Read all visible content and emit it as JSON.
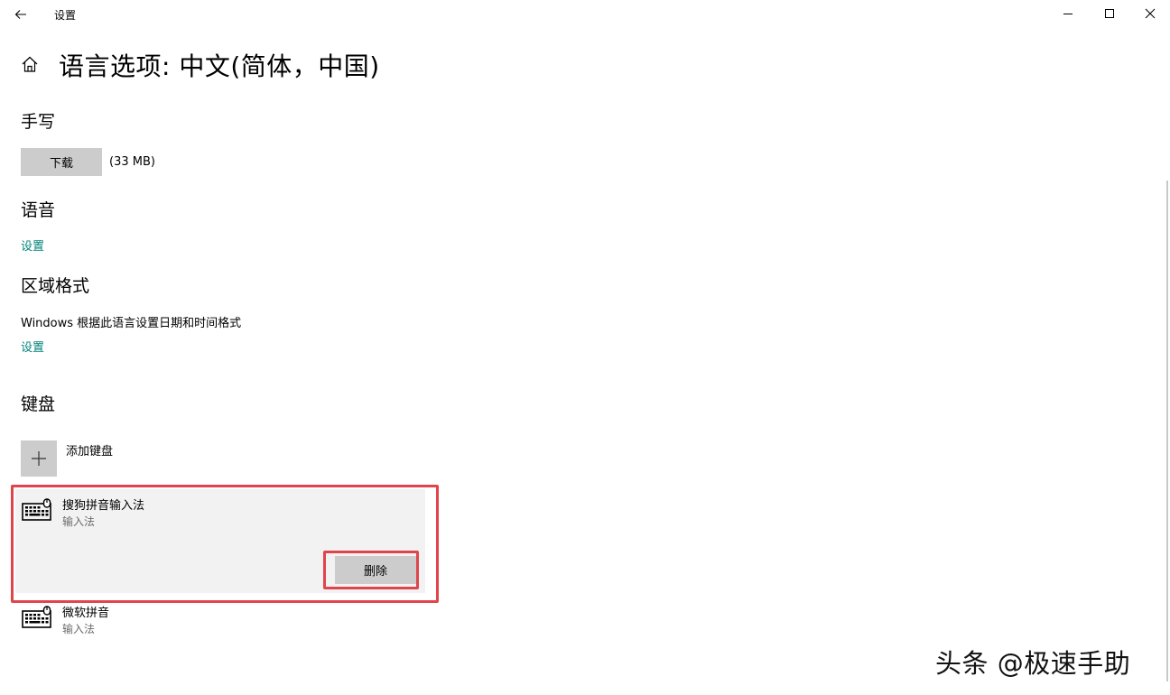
{
  "window": {
    "title": "设置"
  },
  "page": {
    "title": "语言选项: 中文(简体，中国)"
  },
  "handwriting": {
    "title": "手写",
    "download_label": "下载",
    "size_text": "(33 MB)"
  },
  "speech": {
    "title": "语音",
    "settings_link": "设置"
  },
  "region": {
    "title": "区域格式",
    "description": "Windows 根据此语言设置日期和时间格式",
    "settings_link": "设置"
  },
  "keyboard": {
    "title": "键盘",
    "add_label": "添加键盘",
    "items": [
      {
        "name": "搜狗拼音输入法",
        "subtitle": "输入法",
        "action_label": "删除",
        "selected": true
      },
      {
        "name": "微软拼音",
        "subtitle": "输入法",
        "selected": false
      }
    ]
  },
  "watermark": {
    "text": "头条 @极速手助"
  },
  "colors": {
    "link": "#00827a",
    "button_bg": "#cccccc",
    "selected_bg": "#f2f2f2",
    "highlight": "#e0454b"
  },
  "icons": {
    "back": "back-arrow-icon",
    "home": "home-icon",
    "minimize": "minimize-icon",
    "maximize": "maximize-icon",
    "close": "close-icon",
    "add": "plus-icon",
    "keyboard": "keyboard-icon"
  }
}
